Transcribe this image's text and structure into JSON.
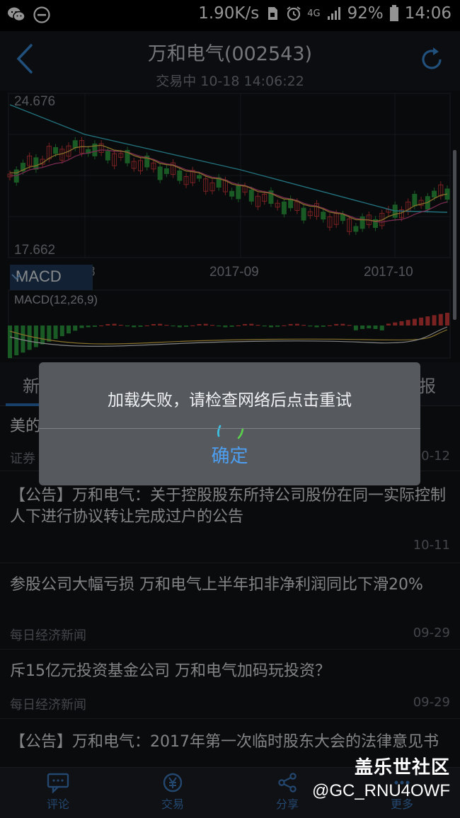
{
  "status_bar": {
    "speed": "1.90K/s",
    "network": "4G",
    "battery": "92%",
    "time": "14:06",
    "left_icons": [
      "wechat-icon",
      "minus-circle-icon"
    ],
    "right_icons": [
      "sim-icon",
      "alarm-icon",
      "signal-icon",
      "battery-icon"
    ]
  },
  "header": {
    "title": "万和电气(002543)",
    "subtitle": "交易中 10-18 14:06:22"
  },
  "chart_data": {
    "type": "candlestick",
    "price_max_label": "24.676",
    "price_min_label": "17.662",
    "x_labels": [
      "8",
      "2017-09",
      "2017-10"
    ],
    "indicator": "MACD",
    "indicator_params": "MACD(12,26,9)",
    "colors": {
      "up": "#d23b3b",
      "down": "#2e9b41",
      "ma5": "#e8c24a",
      "ma10": "#d34a8c",
      "ma20": "#3cc3d6"
    }
  },
  "tabs": {
    "first": "新",
    "last": "报"
  },
  "news": [
    {
      "title": "美的",
      "source": "证券",
      "date": "10-12"
    },
    {
      "title": "【公告】万和电气：关于控股股东所持公司股份在同一实际控制人下进行协议转让完成过户的公告",
      "source": "",
      "date": "10-11"
    },
    {
      "title": "参股公司大幅亏损 万和电气上半年扣非净利润同比下滑20%",
      "source": "每日经济新闻",
      "date": "09-29"
    },
    {
      "title": "斥15亿元投资基金公司 万和电气加码玩投资？",
      "source": "每日经济新闻",
      "date": "09-29"
    },
    {
      "title": "【公告】万和电气：2017年第一次临时股东大会的法律意见书",
      "source": "",
      "date": ""
    }
  ],
  "bottom_bar": {
    "comment": "评论",
    "trade": "交易",
    "share": "分享",
    "more": "更多"
  },
  "watermark": {
    "title": "盖乐世社区",
    "user": "@GC_RNU4OWF"
  },
  "dialog": {
    "message": "加载失败，请检查网络后点击重试",
    "confirm": "确定"
  }
}
